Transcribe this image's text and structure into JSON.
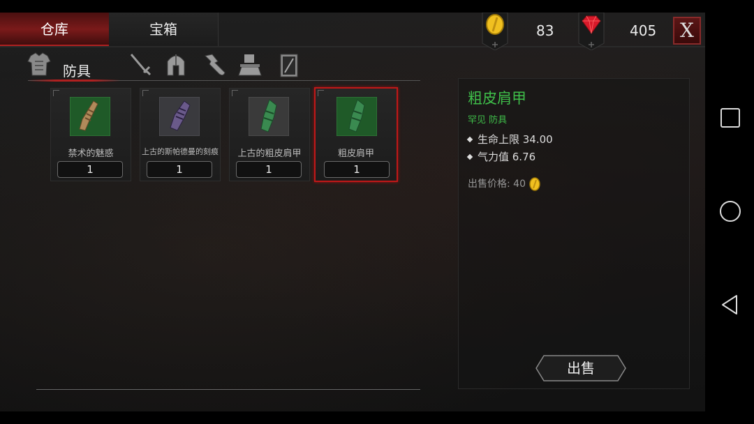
{
  "tabs": {
    "active": "仓库",
    "inactive": "宝箱"
  },
  "currency": {
    "gold": "83",
    "gems": "405"
  },
  "close": {
    "label": "X"
  },
  "category": {
    "active_label": "防具"
  },
  "items": [
    {
      "name": "禁术的魅惑",
      "count": "1"
    },
    {
      "name": "上古的斯帕德曼的刻痕",
      "count": "1"
    },
    {
      "name": "上古的粗皮肩甲",
      "count": "1"
    },
    {
      "name": "粗皮肩甲",
      "count": "1"
    }
  ],
  "detail": {
    "title": "粗皮肩甲",
    "subtitle": "罕见 防具",
    "stats": [
      "生命上限 34.00",
      "气力值 6.76"
    ],
    "price_label": "出售价格:",
    "price_value": "40",
    "sell_label": "出售"
  },
  "colors": {
    "accent_red": "#b02020",
    "rare_green": "#3fbf4a",
    "gold": "#f0c020",
    "gem_red": "#d81a2a"
  },
  "icons": [
    "armor-icon",
    "sword-icon",
    "helmet-icon",
    "potion-icon",
    "anvil-icon",
    "scroll-icon",
    "coin-icon",
    "gem-icon"
  ]
}
